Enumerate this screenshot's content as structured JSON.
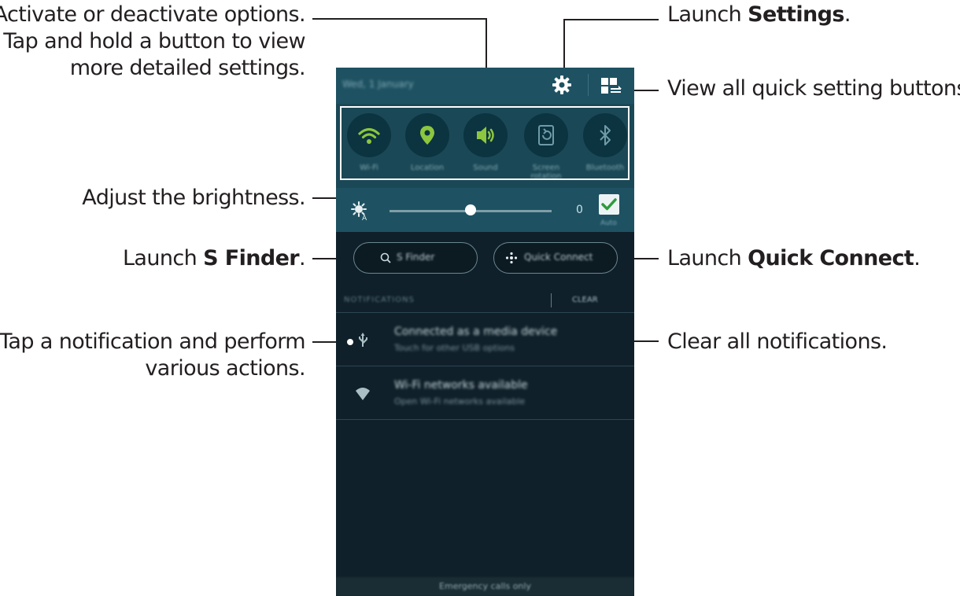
{
  "callouts": {
    "activate_line1": "Activate or deactivate options.",
    "activate_line2": "Tap and hold a button to view",
    "activate_line3": "more detailed settings.",
    "settings_prefix": "Launch ",
    "settings_bold": "Settings",
    "settings_suffix": ".",
    "view_all": "View all quick setting buttons.",
    "brightness": "Adjust the brightness.",
    "sfinder_prefix": "Launch ",
    "sfinder_bold": "S Finder",
    "sfinder_suffix": ".",
    "quickconnect_prefix": "Launch ",
    "quickconnect_bold": "Quick Connect",
    "quickconnect_suffix": ".",
    "notification_line1": "Tap a notification and perform",
    "notification_line2": "various actions.",
    "clear_all": "Clear all notifications."
  },
  "phone": {
    "status": {
      "date": "Wed, 1 January"
    },
    "quick_settings": [
      {
        "label": "Wi-Fi",
        "icon": "wifi-icon",
        "active": true
      },
      {
        "label": "Location",
        "icon": "location-pin-icon",
        "active": true
      },
      {
        "label": "Sound",
        "icon": "sound-icon",
        "active": true
      },
      {
        "label": "Screen rotation",
        "icon": "screen-rotation-icon",
        "active": false
      },
      {
        "label": "Bluetooth",
        "icon": "bluetooth-icon",
        "active": false
      }
    ],
    "brightness": {
      "value": "0",
      "auto_label": "Auto",
      "auto_checked": true,
      "level": 0.5
    },
    "buttons": {
      "s_finder": "S Finder",
      "quick_connect": "Quick Connect"
    },
    "notifications_header": "NOTIFICATIONS",
    "clear_label": "CLEAR",
    "notifications": [
      {
        "title": "Connected as a media device",
        "subtitle": "Touch for other USB options",
        "icon": "usb-icon"
      },
      {
        "title": "Wi-Fi networks available",
        "subtitle": "Open Wi-Fi networks available",
        "icon": "wifi-networks-icon"
      }
    ],
    "emergency": "Emergency calls only"
  },
  "colors": {
    "active_icon": "#8dc63f",
    "panel": "#1e5262",
    "background": "#10202a",
    "leader_line": "#231f20"
  }
}
